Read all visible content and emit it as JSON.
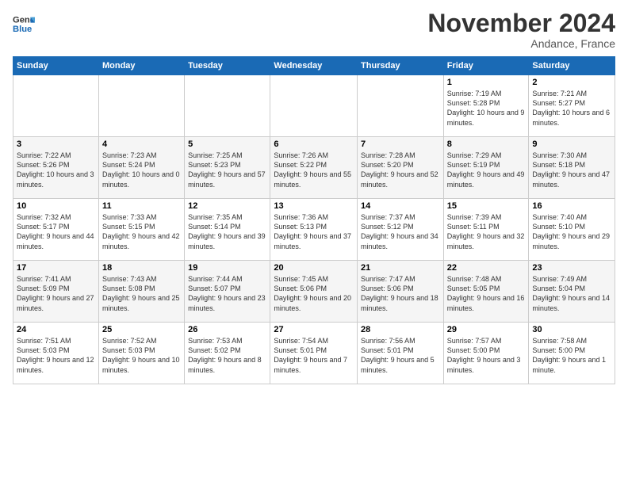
{
  "logo": {
    "text_general": "General",
    "text_blue": "Blue"
  },
  "header": {
    "month": "November 2024",
    "location": "Andance, France"
  },
  "weekdays": [
    "Sunday",
    "Monday",
    "Tuesday",
    "Wednesday",
    "Thursday",
    "Friday",
    "Saturday"
  ],
  "weeks": [
    [
      {
        "day": "",
        "info": ""
      },
      {
        "day": "",
        "info": ""
      },
      {
        "day": "",
        "info": ""
      },
      {
        "day": "",
        "info": ""
      },
      {
        "day": "",
        "info": ""
      },
      {
        "day": "1",
        "info": "Sunrise: 7:19 AM\nSunset: 5:28 PM\nDaylight: 10 hours and 9 minutes."
      },
      {
        "day": "2",
        "info": "Sunrise: 7:21 AM\nSunset: 5:27 PM\nDaylight: 10 hours and 6 minutes."
      }
    ],
    [
      {
        "day": "3",
        "info": "Sunrise: 7:22 AM\nSunset: 5:26 PM\nDaylight: 10 hours and 3 minutes."
      },
      {
        "day": "4",
        "info": "Sunrise: 7:23 AM\nSunset: 5:24 PM\nDaylight: 10 hours and 0 minutes."
      },
      {
        "day": "5",
        "info": "Sunrise: 7:25 AM\nSunset: 5:23 PM\nDaylight: 9 hours and 57 minutes."
      },
      {
        "day": "6",
        "info": "Sunrise: 7:26 AM\nSunset: 5:22 PM\nDaylight: 9 hours and 55 minutes."
      },
      {
        "day": "7",
        "info": "Sunrise: 7:28 AM\nSunset: 5:20 PM\nDaylight: 9 hours and 52 minutes."
      },
      {
        "day": "8",
        "info": "Sunrise: 7:29 AM\nSunset: 5:19 PM\nDaylight: 9 hours and 49 minutes."
      },
      {
        "day": "9",
        "info": "Sunrise: 7:30 AM\nSunset: 5:18 PM\nDaylight: 9 hours and 47 minutes."
      }
    ],
    [
      {
        "day": "10",
        "info": "Sunrise: 7:32 AM\nSunset: 5:17 PM\nDaylight: 9 hours and 44 minutes."
      },
      {
        "day": "11",
        "info": "Sunrise: 7:33 AM\nSunset: 5:15 PM\nDaylight: 9 hours and 42 minutes."
      },
      {
        "day": "12",
        "info": "Sunrise: 7:35 AM\nSunset: 5:14 PM\nDaylight: 9 hours and 39 minutes."
      },
      {
        "day": "13",
        "info": "Sunrise: 7:36 AM\nSunset: 5:13 PM\nDaylight: 9 hours and 37 minutes."
      },
      {
        "day": "14",
        "info": "Sunrise: 7:37 AM\nSunset: 5:12 PM\nDaylight: 9 hours and 34 minutes."
      },
      {
        "day": "15",
        "info": "Sunrise: 7:39 AM\nSunset: 5:11 PM\nDaylight: 9 hours and 32 minutes."
      },
      {
        "day": "16",
        "info": "Sunrise: 7:40 AM\nSunset: 5:10 PM\nDaylight: 9 hours and 29 minutes."
      }
    ],
    [
      {
        "day": "17",
        "info": "Sunrise: 7:41 AM\nSunset: 5:09 PM\nDaylight: 9 hours and 27 minutes."
      },
      {
        "day": "18",
        "info": "Sunrise: 7:43 AM\nSunset: 5:08 PM\nDaylight: 9 hours and 25 minutes."
      },
      {
        "day": "19",
        "info": "Sunrise: 7:44 AM\nSunset: 5:07 PM\nDaylight: 9 hours and 23 minutes."
      },
      {
        "day": "20",
        "info": "Sunrise: 7:45 AM\nSunset: 5:06 PM\nDaylight: 9 hours and 20 minutes."
      },
      {
        "day": "21",
        "info": "Sunrise: 7:47 AM\nSunset: 5:06 PM\nDaylight: 9 hours and 18 minutes."
      },
      {
        "day": "22",
        "info": "Sunrise: 7:48 AM\nSunset: 5:05 PM\nDaylight: 9 hours and 16 minutes."
      },
      {
        "day": "23",
        "info": "Sunrise: 7:49 AM\nSunset: 5:04 PM\nDaylight: 9 hours and 14 minutes."
      }
    ],
    [
      {
        "day": "24",
        "info": "Sunrise: 7:51 AM\nSunset: 5:03 PM\nDaylight: 9 hours and 12 minutes."
      },
      {
        "day": "25",
        "info": "Sunrise: 7:52 AM\nSunset: 5:03 PM\nDaylight: 9 hours and 10 minutes."
      },
      {
        "day": "26",
        "info": "Sunrise: 7:53 AM\nSunset: 5:02 PM\nDaylight: 9 hours and 8 minutes."
      },
      {
        "day": "27",
        "info": "Sunrise: 7:54 AM\nSunset: 5:01 PM\nDaylight: 9 hours and 7 minutes."
      },
      {
        "day": "28",
        "info": "Sunrise: 7:56 AM\nSunset: 5:01 PM\nDaylight: 9 hours and 5 minutes."
      },
      {
        "day": "29",
        "info": "Sunrise: 7:57 AM\nSunset: 5:00 PM\nDaylight: 9 hours and 3 minutes."
      },
      {
        "day": "30",
        "info": "Sunrise: 7:58 AM\nSunset: 5:00 PM\nDaylight: 9 hours and 1 minute."
      }
    ]
  ]
}
